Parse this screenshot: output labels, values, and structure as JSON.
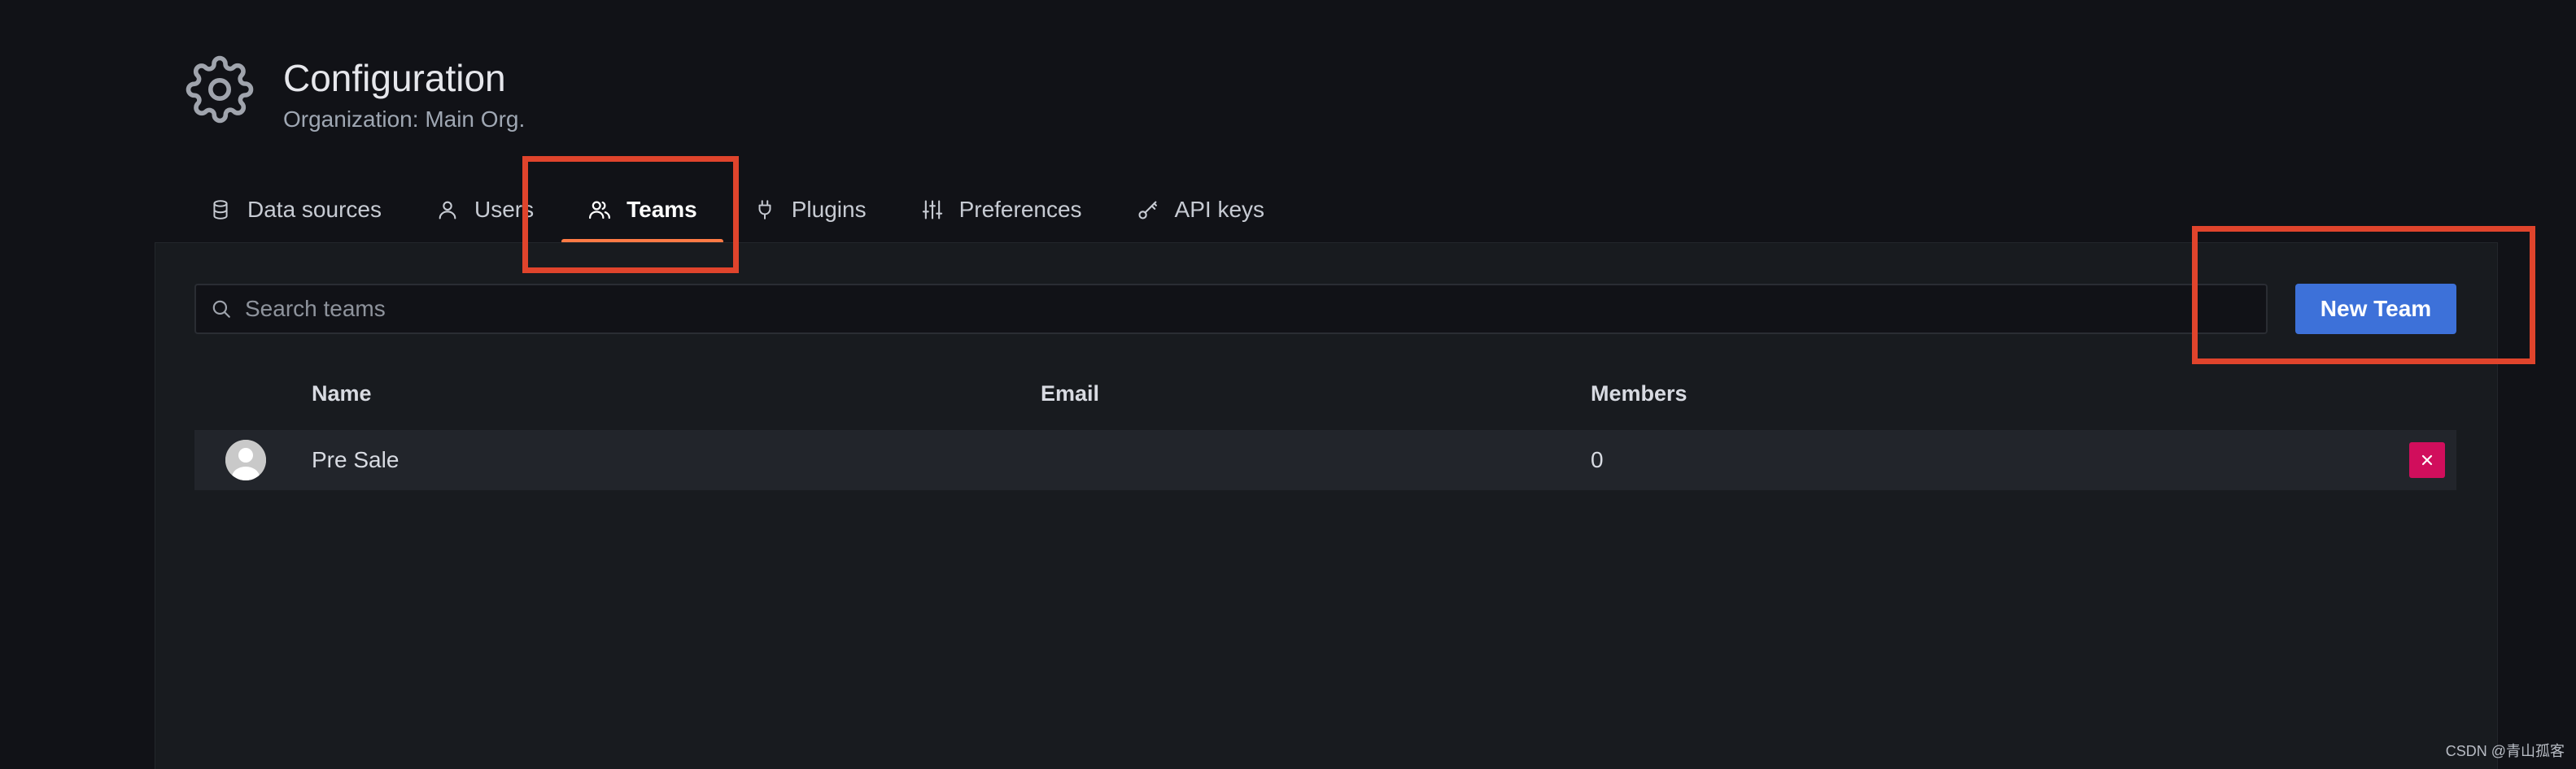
{
  "header": {
    "icon": "gear-icon",
    "title": "Configuration",
    "subtitle": "Organization: Main Org."
  },
  "tabs": [
    {
      "label": "Data sources",
      "icon": "database-icon",
      "active": false
    },
    {
      "label": "Users",
      "icon": "user-icon",
      "active": false
    },
    {
      "label": "Teams",
      "icon": "users-icon",
      "active": true
    },
    {
      "label": "Plugins",
      "icon": "plug-icon",
      "active": false
    },
    {
      "label": "Preferences",
      "icon": "sliders-icon",
      "active": false
    },
    {
      "label": "API keys",
      "icon": "key-icon",
      "active": false
    }
  ],
  "search": {
    "placeholder": "Search teams",
    "value": ""
  },
  "actions": {
    "new_team_label": "New Team"
  },
  "table": {
    "columns": [
      "Name",
      "Email",
      "Members"
    ],
    "rows": [
      {
        "name": "Pre Sale",
        "email": "",
        "members": "0"
      }
    ]
  },
  "colors": {
    "background": "#111217",
    "panel": "#181b1f",
    "primary_button": "#3d71d9",
    "delete_button": "#d10e5c",
    "active_tab_underline": "#ff7a45",
    "annotation": "#e0442c"
  },
  "watermark": "CSDN @青山孤客"
}
